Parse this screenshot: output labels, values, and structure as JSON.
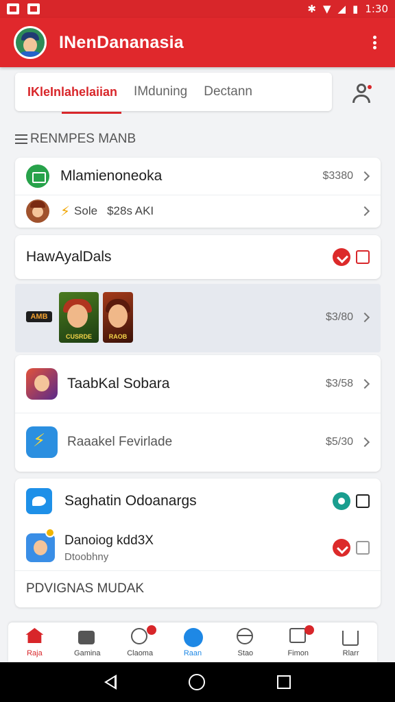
{
  "status_bar": {
    "time": "1:30"
  },
  "app_bar": {
    "title": "INenDananasia"
  },
  "tabs": [
    {
      "label": "IKleInlahelaiian",
      "active": true
    },
    {
      "label": "IMduning",
      "active": false
    },
    {
      "label": "Dectann",
      "active": false
    }
  ],
  "section": {
    "title": "RENMPES MANB"
  },
  "card1": {
    "row1": {
      "title": "Mlamienoneoka",
      "price": "$3380"
    },
    "row2": {
      "label": "Sole",
      "meta": "$28s AKI"
    }
  },
  "card2": {
    "title": "HawAyalDals"
  },
  "promo": {
    "logo": "AMB",
    "cover1_label": "CUSRDE",
    "cover2_label": "RAOB",
    "price": "$3/80"
  },
  "card3": {
    "row1": {
      "title": "TaabKal Sobara",
      "price": "$3/58"
    },
    "row2": {
      "title": "Raaakel Fevirlade",
      "price": "$5/30"
    }
  },
  "card4": {
    "row1": {
      "title": "Saghatin Odoanargs"
    },
    "row2": {
      "title": "Danoiog kdd3X",
      "subtitle": "Dtoobhny"
    },
    "footer": "PDVIGNAS MUDAK"
  },
  "bottom_nav": [
    {
      "label": "Raja",
      "icon": "home-icon"
    },
    {
      "label": "Gamina",
      "icon": "bag-icon"
    },
    {
      "label": "Claoma",
      "icon": "clock-icon"
    },
    {
      "label": "Raan",
      "icon": "blue-circle-icon"
    },
    {
      "label": "Stao",
      "icon": "globe-icon"
    },
    {
      "label": "Fimon",
      "icon": "box-icon"
    },
    {
      "label": "Rlarr",
      "icon": "share-icon"
    }
  ],
  "colors": {
    "primary": "#e0282c",
    "accent_blue": "#1e88e5"
  }
}
